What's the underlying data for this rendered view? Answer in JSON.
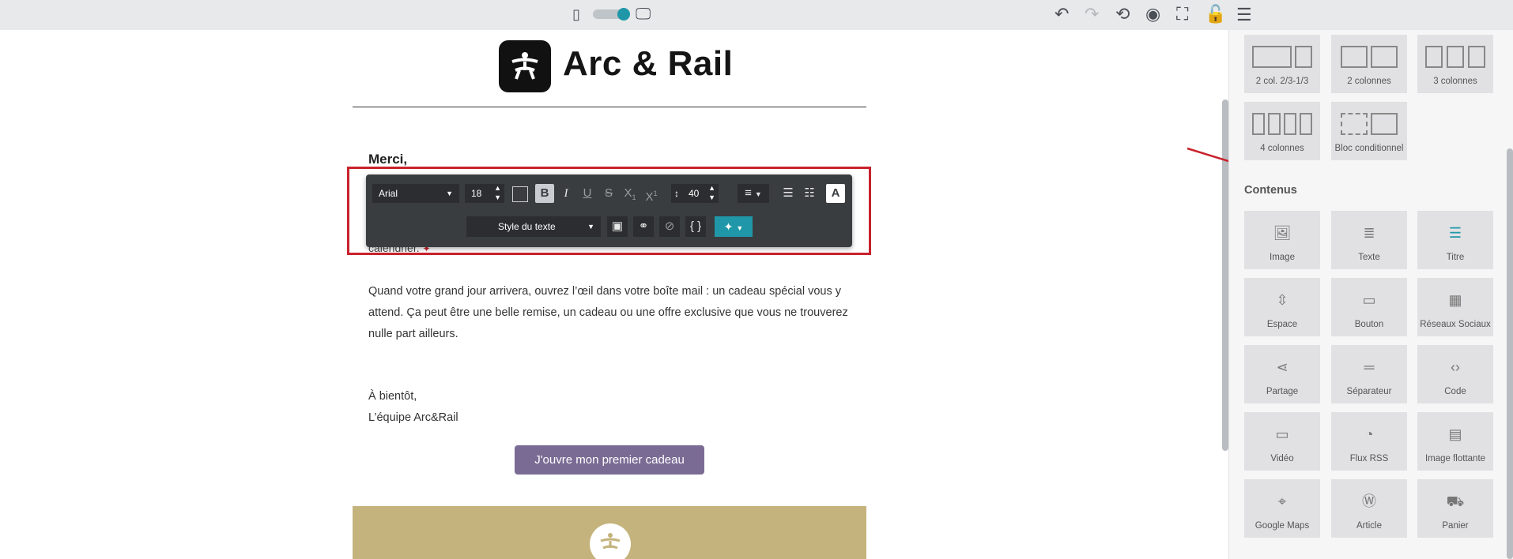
{
  "toolbar_top": {
    "icons": [
      "mobile-icon",
      "view-toggle",
      "desktop-icon",
      "undo-icon",
      "redo-icon",
      "history-icon",
      "preview-eye-icon",
      "fullscreen-icon",
      "unlock-icon",
      "panel-toggle-icon"
    ]
  },
  "email": {
    "brand": "Arc & Rail",
    "greeting": "Merci,",
    "partial_line": "calendrier.",
    "paragraph": "Quand votre grand jour arrivera, ouvrez l’œil dans votre boîte mail : un cadeau spécial vous y attend. Ça peut être une belle remise, un cadeau ou une offre exclusive que vous ne trouverez nulle part ailleurs.",
    "signoff_1": "À bientôt,",
    "signoff_2": "L’équipe Arc&Rail",
    "cta": "J'ouvre mon premier cadeau"
  },
  "text_toolbar": {
    "font": "Arial",
    "size": "18",
    "line_height": "40",
    "style_select": "Style du texte"
  },
  "panel": {
    "layouts": [
      {
        "label": "2 col. 2/3-1/3"
      },
      {
        "label": "2 colonnes"
      },
      {
        "label": "3 colonnes"
      },
      {
        "label": "4 colonnes"
      },
      {
        "label": "Bloc conditionnel"
      }
    ],
    "section_title": "Contenus",
    "contents": [
      {
        "label": "Image",
        "icon": "image-icon"
      },
      {
        "label": "Texte",
        "icon": "text-icon"
      },
      {
        "label": "Titre",
        "icon": "title-icon"
      },
      {
        "label": "Espace",
        "icon": "spacer-icon"
      },
      {
        "label": "Bouton",
        "icon": "button-icon"
      },
      {
        "label": "Réseaux Sociaux",
        "icon": "social-icon"
      },
      {
        "label": "Partage",
        "icon": "share-icon"
      },
      {
        "label": "Séparateur",
        "icon": "divider-icon"
      },
      {
        "label": "Code",
        "icon": "code-icon"
      },
      {
        "label": "Vidéo",
        "icon": "video-icon"
      },
      {
        "label": "Flux RSS",
        "icon": "rss-icon"
      },
      {
        "label": "Image flottante",
        "icon": "floating-image-icon"
      },
      {
        "label": "Google Maps",
        "icon": "map-pin-icon"
      },
      {
        "label": "Article",
        "icon": "wordpress-icon"
      },
      {
        "label": "Panier",
        "icon": "cart-icon"
      }
    ]
  },
  "colors": {
    "accent": "#1f97a8",
    "cta": "#7a6b94",
    "highlight": "#c8222c",
    "footer": "#c4b37c"
  }
}
